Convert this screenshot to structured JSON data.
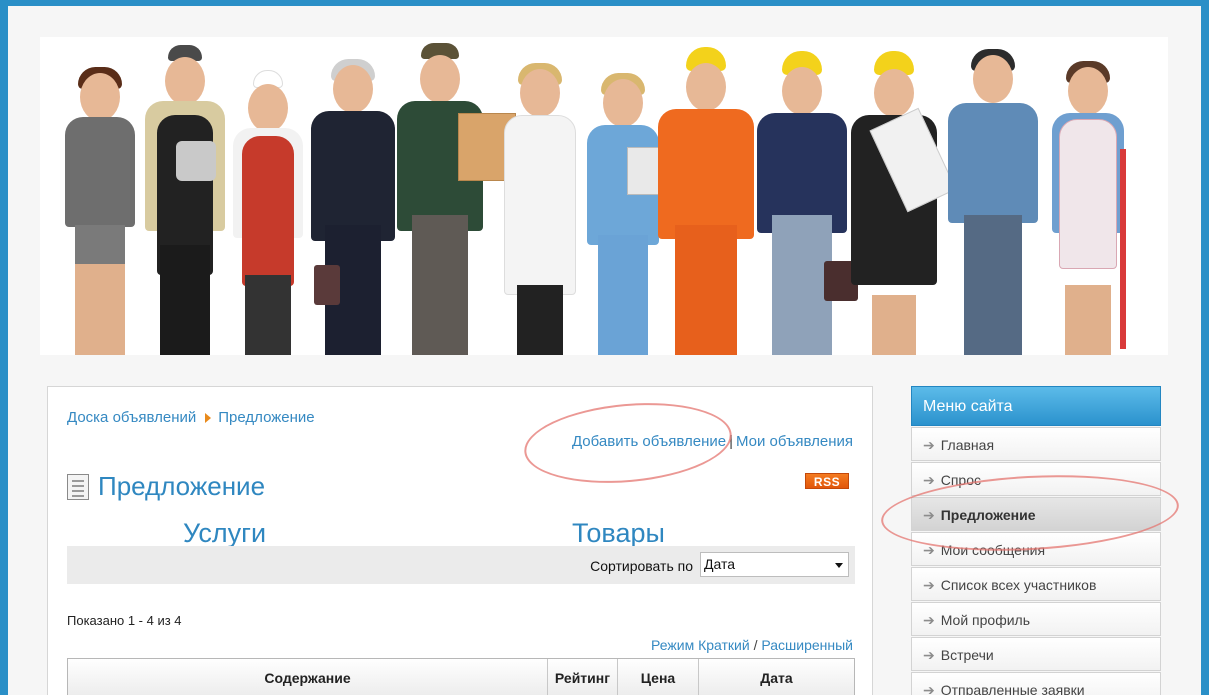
{
  "breadcrumb": {
    "root": "Доска объявлений",
    "current": "Предложение"
  },
  "top_links": {
    "add": "Добавить объявление",
    "separator": "|",
    "mine": "Мои объявления"
  },
  "page": {
    "title": "Предложение",
    "rss": "RSS"
  },
  "categories": [
    "Услуги",
    "Товары"
  ],
  "sort": {
    "label": "Сортировать по",
    "value": "Дата"
  },
  "results": {
    "shown": "Показано 1 - 4 из 4"
  },
  "view_mode": {
    "brief": "Режим Краткий",
    "separator": "/",
    "extended": "Расширенный"
  },
  "table": {
    "headers": [
      "Содержание",
      "Рейтинг",
      "Цена",
      "Дата"
    ]
  },
  "sidebar": {
    "title": "Меню сайта",
    "items": [
      {
        "label": "Главная"
      },
      {
        "label": "Спрос"
      },
      {
        "label": "Предложение",
        "active": true
      },
      {
        "label": "Мои сообщения"
      },
      {
        "label": "Список всех участников"
      },
      {
        "label": "Мой профиль"
      },
      {
        "label": "Встречи"
      },
      {
        "label": "Отправленные заявки"
      }
    ],
    "arrow": "➔"
  },
  "colors": {
    "background": "#2a8fc7",
    "link": "#3589c2",
    "menu_header": "#2b92cd",
    "breadcrumb_arrow": "#e98a1b",
    "rss": "#f47b20",
    "highlight_oval": "#e47670"
  }
}
